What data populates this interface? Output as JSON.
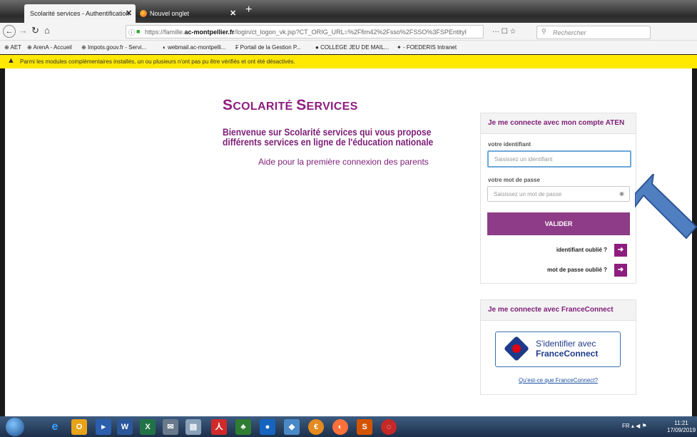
{
  "browser": {
    "tabs": [
      {
        "title": "Scolarité services - Authentification"
      },
      {
        "title": "Nouvel onglet"
      }
    ],
    "url_prefix": "https://famille.",
    "url_domain": "ac-montpellier.fr",
    "url_path": "/login/ct_logon_vk.jsp?CT_ORIG_URL=%2Ffim42%2Fsso%2FSSO%3FSPEntityI",
    "search_placeholder": "Rechercher",
    "page_actions": "··· ☐ ☆",
    "bookmarks": [
      "AET",
      "ArenA - Accueil",
      "Impots.gouv.fr - Servi...",
      "webmail.ac-montpelli...",
      "Portail de la Gestion P...",
      "COLLEGE JEU DE MAIL...",
      "- FOEDERIS Intranet"
    ],
    "warning": "Parmi les modules complémentaires installés, un ou plusieurs n'ont pas pu être vérifiés et ont été désactivés."
  },
  "page": {
    "brand_initial_1": "S",
    "brand_rest_1": "COLARITÉ ",
    "brand_initial_2": "S",
    "brand_rest_2": "ERVICES",
    "welcome_line1": "Bienvenue sur Scolarité services qui vous propose",
    "welcome_line2": "différents services en ligne de l'éducation nationale",
    "help_link": "Aide pour la première connexion des parents"
  },
  "login": {
    "heading": "Je me connecte avec mon compte ATEN",
    "id_label": "votre identifiant",
    "id_placeholder": "Saisissez un identifiant",
    "pw_label": "votre mot de passe",
    "pw_placeholder": "Saisissez un mot de passe",
    "submit": "VALIDER",
    "forgot_id": "identifiant oublié ?",
    "forgot_pw": "mot de passe oublié ?"
  },
  "franceconnect": {
    "heading": "Je me connecte avec FranceConnect",
    "btn_line1": "S'identifier avec",
    "btn_line2": "FranceConnect",
    "what_link": "Qu'est-ce que FranceConnect?"
  },
  "taskbar": {
    "lang": "FR",
    "time": "11:21",
    "date": "17/09/2019"
  },
  "colors": {
    "brand_purple": "#8e1d7f",
    "button_purple": "#8e3c87",
    "warning_yellow": "#ffe900",
    "annotation_arrow": "#4f7ec1"
  }
}
